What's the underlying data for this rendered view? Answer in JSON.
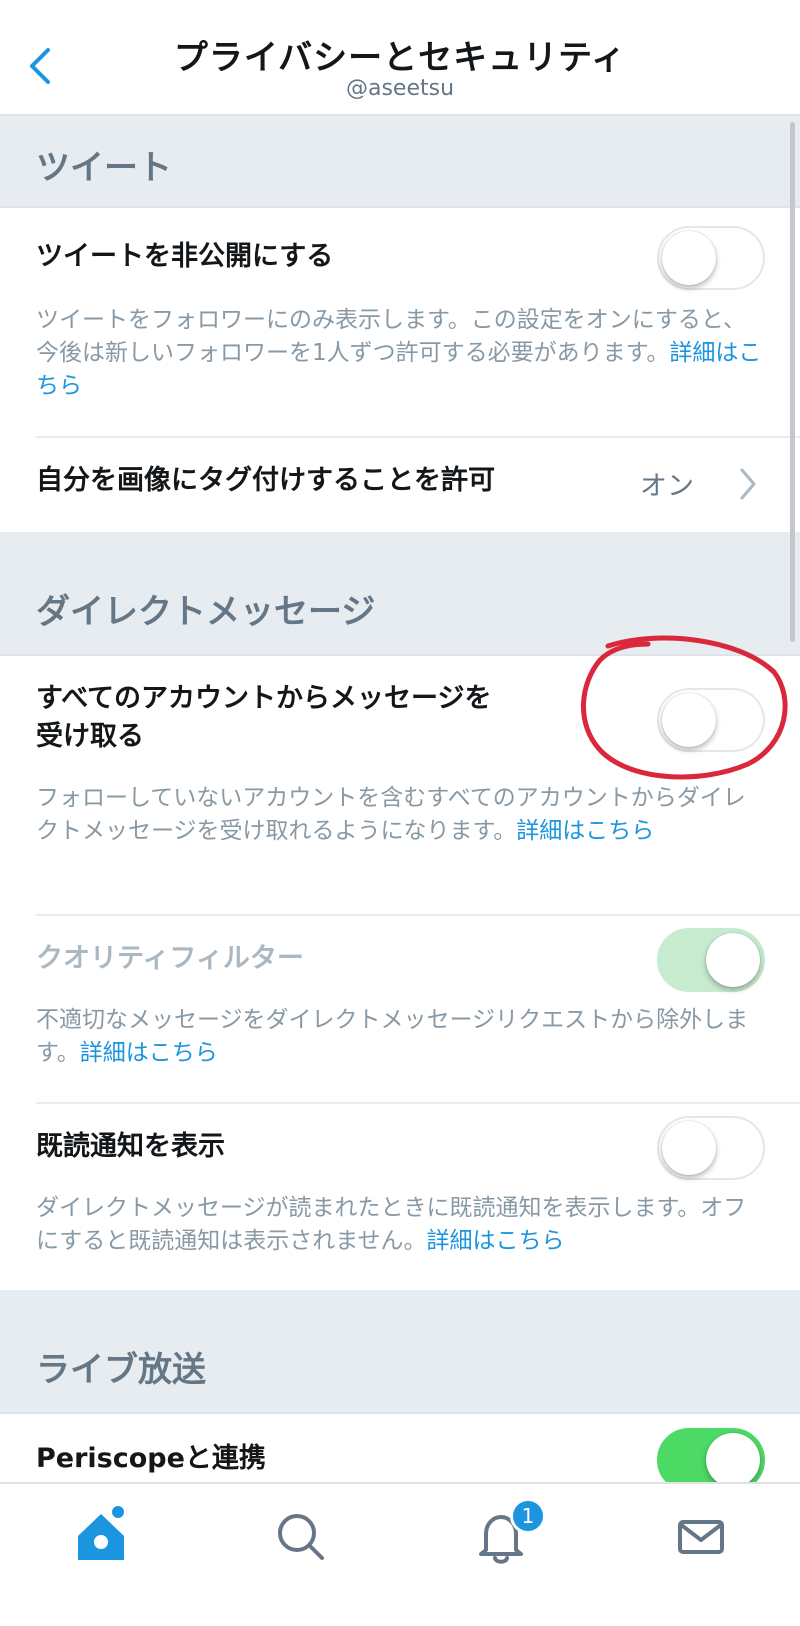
{
  "header": {
    "title": "プライバシーとセキュリティ",
    "username": "@aseetsu"
  },
  "sections": {
    "tweets": {
      "title": "ツイート",
      "protect": {
        "label": "ツイートを非公開にする",
        "enabled": false,
        "desc": "ツイートをフォロワーにのみ表示します。この設定をオンにすると、今後は新しいフォロワーを1人ずつ許可する必要があります。",
        "link": "詳細はこちら"
      },
      "photo_tagging": {
        "label": "自分を画像にタグ付けすることを許可",
        "value": "オン"
      }
    },
    "dm": {
      "title": "ダイレクトメッセージ",
      "receive_all": {
        "label_line1": "すべてのアカウントからメッセージを",
        "label_line2": "受け取る",
        "enabled": false,
        "desc": "フォローしていないアカウントを含むすべてのアカウントからダイレクトメッセージを受け取れるようになります。",
        "link": "詳細はこちら"
      },
      "quality_filter": {
        "label": "クオリティフィルター",
        "enabled": true,
        "disabled": true,
        "desc": "不適切なメッセージをダイレクトメッセージリクエストから除外します。",
        "link": "詳細はこちら"
      },
      "read_receipts": {
        "label": "既読通知を表示",
        "enabled": false,
        "desc": "ダイレクトメッセージが読まれたときに既読通知を表示します。オフにすると既読通知は表示されません。",
        "link": "詳細はこちら"
      }
    },
    "live": {
      "title": "ライブ放送",
      "periscope": {
        "label": "Periscopeと連携",
        "enabled": true
      }
    }
  },
  "tabbar": {
    "active": "home",
    "notification_badge": "1"
  },
  "colors": {
    "accent": "#1b95e0",
    "toggle_on": "#4cd964",
    "annotation": "#d9283b"
  },
  "icons": [
    "back-chevron-icon",
    "chevron-right-icon",
    "home-icon",
    "search-icon",
    "bell-icon",
    "mail-icon"
  ]
}
